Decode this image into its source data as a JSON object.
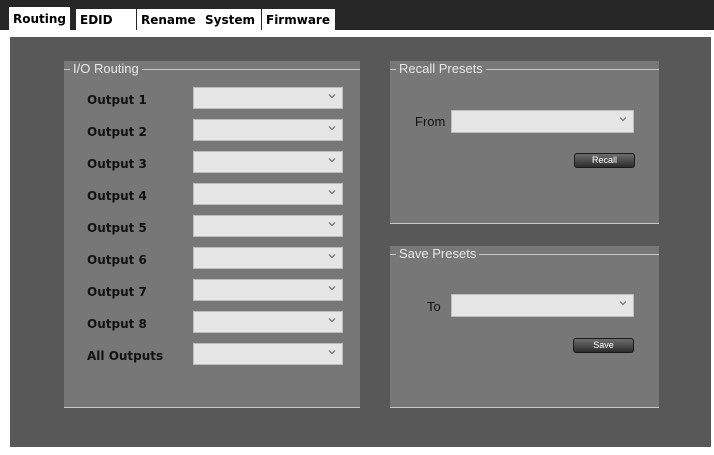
{
  "tabs": [
    {
      "label": "Routing",
      "active": true
    },
    {
      "label": "EDID",
      "active": false
    },
    {
      "label": "Rename",
      "active": false
    },
    {
      "label": "System",
      "active": false
    },
    {
      "label": "Firmware",
      "active": false
    }
  ],
  "io_routing": {
    "title": "I/O Routing",
    "outputs": [
      {
        "label": "Output 1",
        "value": ""
      },
      {
        "label": "Output 2",
        "value": ""
      },
      {
        "label": "Output 3",
        "value": ""
      },
      {
        "label": "Output 4",
        "value": ""
      },
      {
        "label": "Output 5",
        "value": ""
      },
      {
        "label": "Output 6",
        "value": ""
      },
      {
        "label": "Output 7",
        "value": ""
      },
      {
        "label": "Output 8",
        "value": ""
      },
      {
        "label": "All Outputs",
        "value": ""
      }
    ]
  },
  "recall_presets": {
    "title": "Recall Presets",
    "from_label": "From",
    "from_value": "",
    "button_label": "Recall"
  },
  "save_presets": {
    "title": "Save Presets",
    "to_label": "To",
    "to_value": "",
    "button_label": "Save"
  },
  "colors": {
    "panel_bg": "#585858",
    "group_bg": "#777777",
    "dropdown_bg": "#e6e6e6"
  }
}
